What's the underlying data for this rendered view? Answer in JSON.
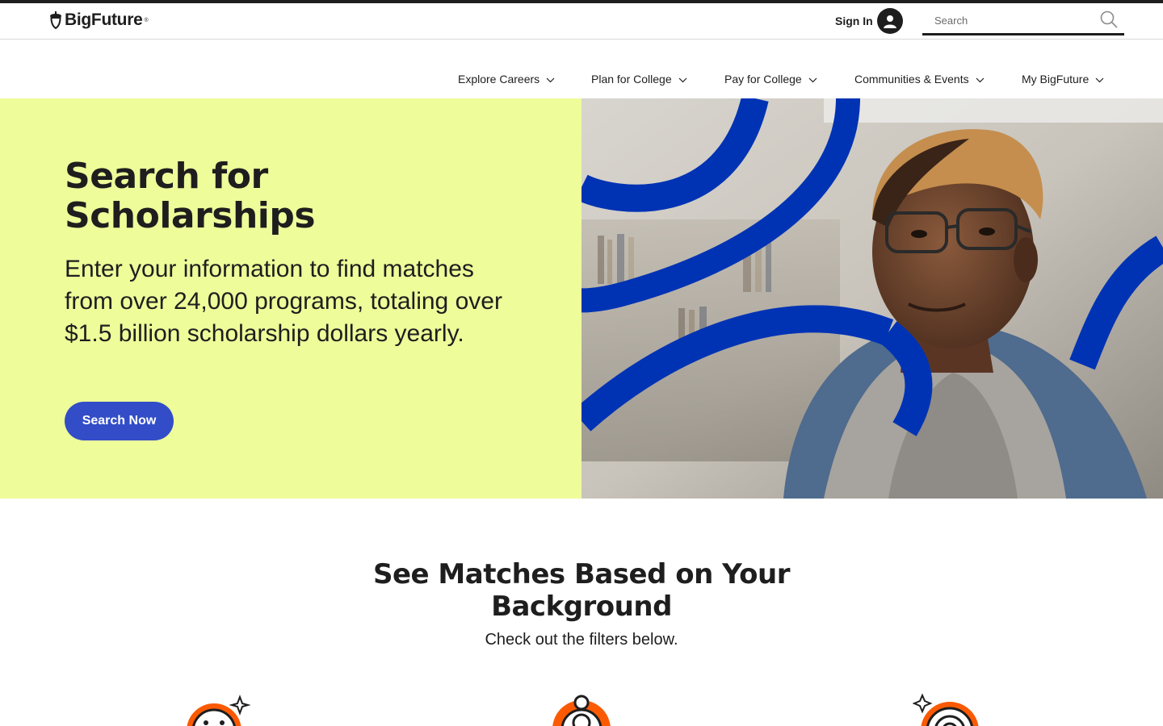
{
  "header": {
    "logo_text": "BigFuture",
    "logo_mark": "®",
    "signin_label": "Sign In",
    "search_placeholder": "Search"
  },
  "nav": {
    "items": [
      {
        "label": "Explore Careers"
      },
      {
        "label": "Plan for College"
      },
      {
        "label": "Pay for College"
      },
      {
        "label": "Communities & Events"
      },
      {
        "label": "My BigFuture"
      }
    ]
  },
  "hero": {
    "title": "Search for Scholarships",
    "description": "Enter your information to find matches from over 24,000 programs, totaling over $1.5 billion scholarship dollars yearly.",
    "button_label": "Search Now",
    "image_alt": "Student with glasses in library"
  },
  "section": {
    "title": "See Matches Based on Your Background",
    "subtitle": "Check out the filters below."
  },
  "colors": {
    "hero_bg": "#eefc9a",
    "button": "#324dc7",
    "swirl": "#0033b4",
    "accent_orange": "#fb5a03",
    "text": "#1e1e1e"
  },
  "icons": {
    "search": "search-icon",
    "user": "user-icon",
    "chevron": "chevron-down-icon",
    "filter_1": "smiley-sparkle-icon",
    "filter_2": "person-ring-icon",
    "filter_3": "badge-sparkle-icon"
  }
}
